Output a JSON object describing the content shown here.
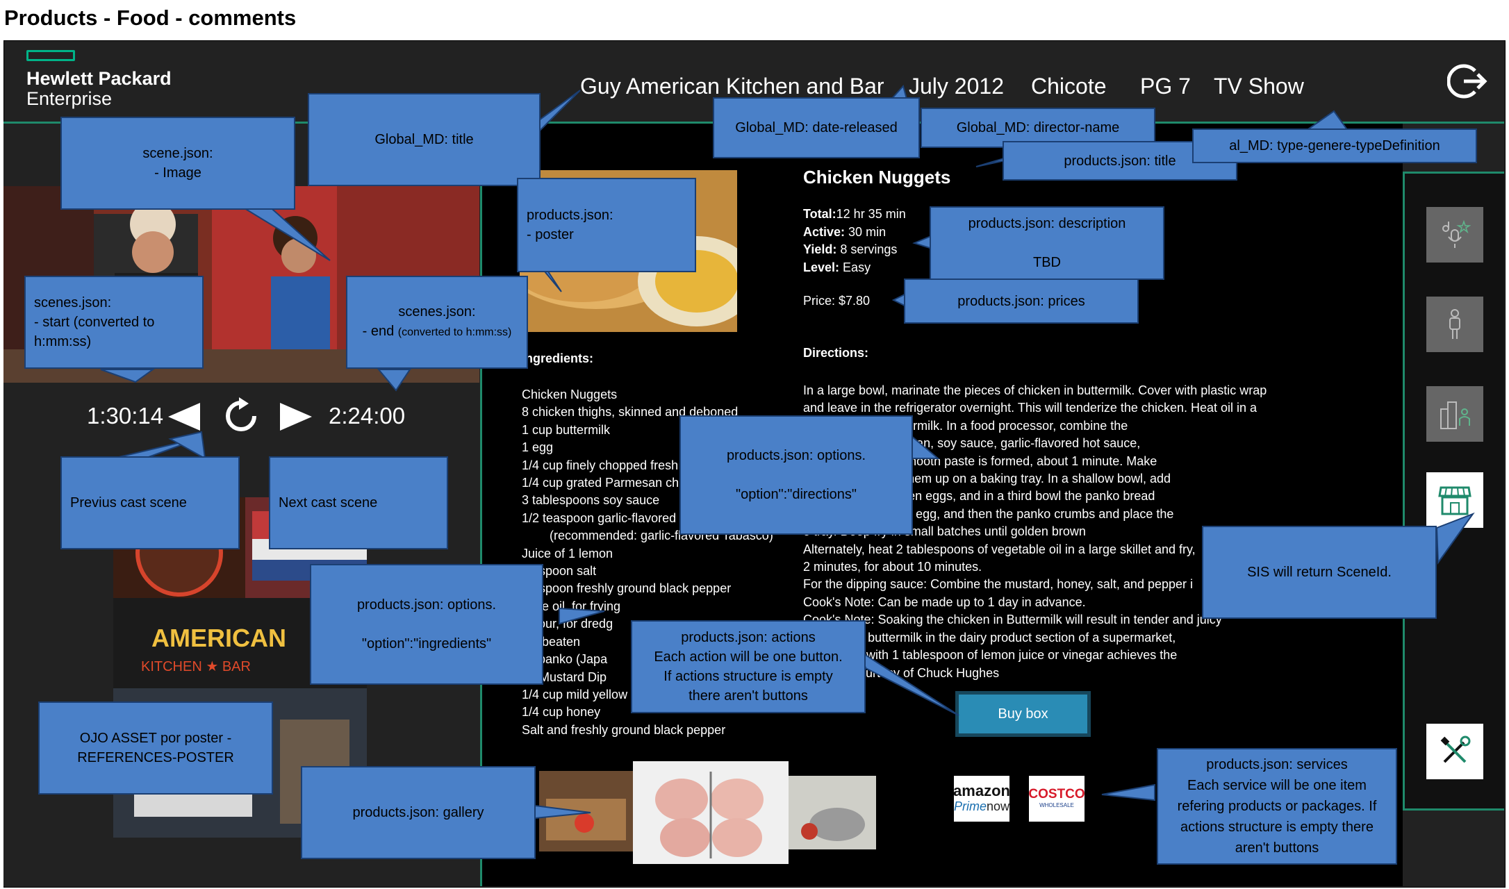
{
  "page_title": "Products - Food - comments",
  "brand": {
    "line1": "Hewlett Packard",
    "line2": "Enterprise"
  },
  "header": {
    "title": "Guy American Kitchen and Bar",
    "date": "July 2012",
    "director": "Chicote",
    "rating": "PG 7",
    "type": "TV Show"
  },
  "player": {
    "start_time": "1:30:14",
    "end_time": "2:24:00"
  },
  "product": {
    "title": "Chicken Nuggets",
    "total_label": "Total:",
    "total_value": "12 hr 35 min",
    "active_label": "Active:",
    "active_value": "30 min",
    "yield_label": "Yield:",
    "yield_value": "8 servings",
    "level_label": "Level:",
    "level_value": "Easy",
    "price": "Price: $7.80",
    "ingredients_title": "Ingredients:",
    "ingredients": [
      "Chicken Nuggets",
      "8 chicken thighs, skinned and deboned",
      "1 cup buttermilk",
      "1 egg",
      "1/4 cup finely chopped fresh",
      "1/4 cup grated Parmesan ch",
      "3 tablespoons soy sauce",
      "1/2 teaspoon garlic-flavored",
      "(recommended: garlic-flavored Tabasco)",
      "Juice of 1 lemon",
      "teaspoon salt",
      "teaspoon freshly ground black pepper",
      "table oil, for frying",
      "p flour, for dredg",
      "gs, beaten",
      "ps panko (Japa",
      "ey-Mustard Dip",
      "1/4 cup mild yellow",
      "1/4 cup honey",
      "Salt and freshly ground black pepper"
    ],
    "directions_title": "Directions:",
    "directions": [
      "In a large bowl, marinate the pieces of chicken in buttermilk. Cover with plastic wrap",
      "and leave in the refrigerator overnight. This will tenderize the chicken. Heat oil in a",
      "nd discard the buttermilk. In a food processor, combine the",
      "egg, chives, Parmesan, soy sauce, garlic-flavored hot sauce,",
      "per. Blend until a smooth paste is formed, about 1 minute. Make",
      "ch nuggets, lining them up on a baking tray. In a shallow bowl, add",
      "cond bowl the beaten eggs, and in a third bowl the panko bread",
      "uggets in flour, then egg, and then the panko crumbs and place the",
      "e tray. Deep fry in small batches until golden brown",
      "Alternately, heat 2 tablespoons of vegetable oil in a large skillet and fry,",
      "2 minutes, for about 10 minutes.",
      "For the dipping sauce: Combine the mustard, honey, salt, and pepper i",
      "Cook's Note: Can be made up to 1 day in advance.",
      "Cook's Note: Soaking the chicken in Buttermilk will result in tender and juicy",
      "ou can buy buttermilk in the dairy product section of a supermarket,",
      "cup of milk with 1 tablespoon of lemon juice or vinegar achieves the",
      "t.Recipe courtesy of Chuck Hughes"
    ],
    "buy_button": "Buy box"
  },
  "services": [
    {
      "name": "amazon",
      "line1": "amazon",
      "line2": "Prime",
      "line3": "now"
    },
    {
      "name": "costco",
      "line1": "COSTCO",
      "line2": "WHOLESALE"
    }
  ],
  "gallery_texts": {
    "g1": "AMERICAN",
    "g2": "KITCHEN ★ BAR"
  },
  "callouts": {
    "global_title": "Global_MD: title",
    "date_released": "Global_MD: date-released",
    "director_name": "Global_MD: director-name",
    "products_title": "products.json: title",
    "type_genre": "al_MD: type-genere-typeDefinition",
    "scene_image": "scene.json:\n- Image",
    "poster": "products.json:\n- poster",
    "description": "products.json: description\n\nTBD",
    "prices": "products.json: prices",
    "scene_start": "scenes.json:\n- start (converted to\nh:mm:ss)",
    "scene_end_a": "scenes.json:",
    "scene_end_b": "- end",
    "scene_end_c": "(converted to h:mm:ss)",
    "directions": "products.json: options.\n\n\"option\":\"directions\"",
    "sis": "SIS will return SceneId.",
    "prev_scene": "Previus cast scene",
    "next_scene": "Next cast scene",
    "ingredients": "products.json: options.\n\n\"option\":\"ingredients\"",
    "actions": "products.json: actions\nEach action will be one button.\nIf actions structure is empty\nthere aren't buttons",
    "ojo_asset": "OJO ASSET por poster -\nREFERENCES-POSTER",
    "gallery": "products.json: gallery",
    "services": "products.json: services\nEach service will be one item\nrefering products or packages. If\nactions structure is empty there\naren't buttons"
  },
  "colors": {
    "accent": "#1f8a6b",
    "callout": "#4a80c8",
    "buy": "#2a8cb5"
  },
  "icons": [
    "logout-icon",
    "music-mic-icon",
    "person-icon",
    "city-person-icon",
    "store-icon",
    "tools-icon",
    "rewind-icon",
    "replay-icon",
    "play-icon"
  ]
}
